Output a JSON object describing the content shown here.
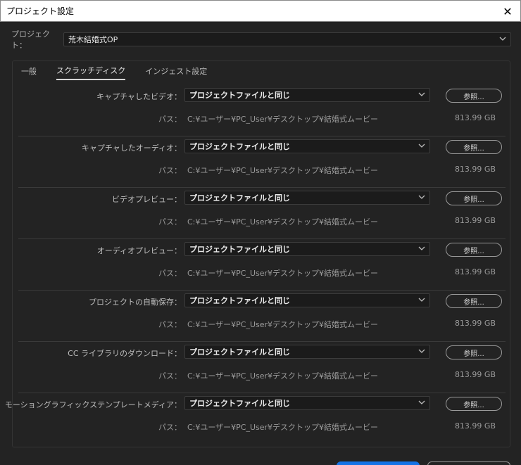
{
  "window": {
    "title": "プロジェクト設定",
    "close_glyph": "✕"
  },
  "project": {
    "label": "プロジェクト：",
    "value": "荒木結婚式OP"
  },
  "tabs": [
    {
      "label": "一般",
      "active": false
    },
    {
      "label": "スクラッチディスク",
      "active": true
    },
    {
      "label": "インジェスト設定",
      "active": false
    }
  ],
  "sections": [
    {
      "label": "キャプチャしたビデオ：",
      "value": "プロジェクトファイルと同じ",
      "browse": "参照...",
      "path_label": "パス：",
      "path": "C:¥ユーザー¥PC_User¥デスクトップ¥結婚式ムービー",
      "size": "813.99 GB"
    },
    {
      "label": "キャプチャしたオーディオ：",
      "value": "プロジェクトファイルと同じ",
      "browse": "参照...",
      "path_label": "パス：",
      "path": "C:¥ユーザー¥PC_User¥デスクトップ¥結婚式ムービー",
      "size": "813.99 GB"
    },
    {
      "label": "ビデオプレビュー：",
      "value": "プロジェクトファイルと同じ",
      "browse": "参照...",
      "path_label": "パス：",
      "path": "C:¥ユーザー¥PC_User¥デスクトップ¥結婚式ムービー",
      "size": "813.99 GB"
    },
    {
      "label": "オーディオプレビュー：",
      "value": "プロジェクトファイルと同じ",
      "browse": "参照...",
      "path_label": "パス：",
      "path": "C:¥ユーザー¥PC_User¥デスクトップ¥結婚式ムービー",
      "size": "813.99 GB"
    },
    {
      "label": "プロジェクトの自動保存：",
      "value": "プロジェクトファイルと同じ",
      "browse": "参照...",
      "path_label": "パス：",
      "path": "C:¥ユーザー¥PC_User¥デスクトップ¥結婚式ムービー",
      "size": "813.99 GB"
    },
    {
      "label": "CC ライブラリのダウンロード：",
      "value": "プロジェクトファイルと同じ",
      "browse": "参照...",
      "path_label": "パス：",
      "path": "C:¥ユーザー¥PC_User¥デスクトップ¥結婚式ムービー",
      "size": "813.99 GB"
    },
    {
      "label": "モーショングラフィックステンプレートメディア：",
      "value": "プロジェクトファイルと同じ",
      "browse": "参照...",
      "path_label": "パス：",
      "path": "C:¥ユーザー¥PC_User¥デスクトップ¥結婚式ムービー",
      "size": "813.99 GB"
    }
  ],
  "colors": {
    "background": "#232323",
    "primary_button": "#1473e6",
    "titlebar": "#ffffff"
  }
}
